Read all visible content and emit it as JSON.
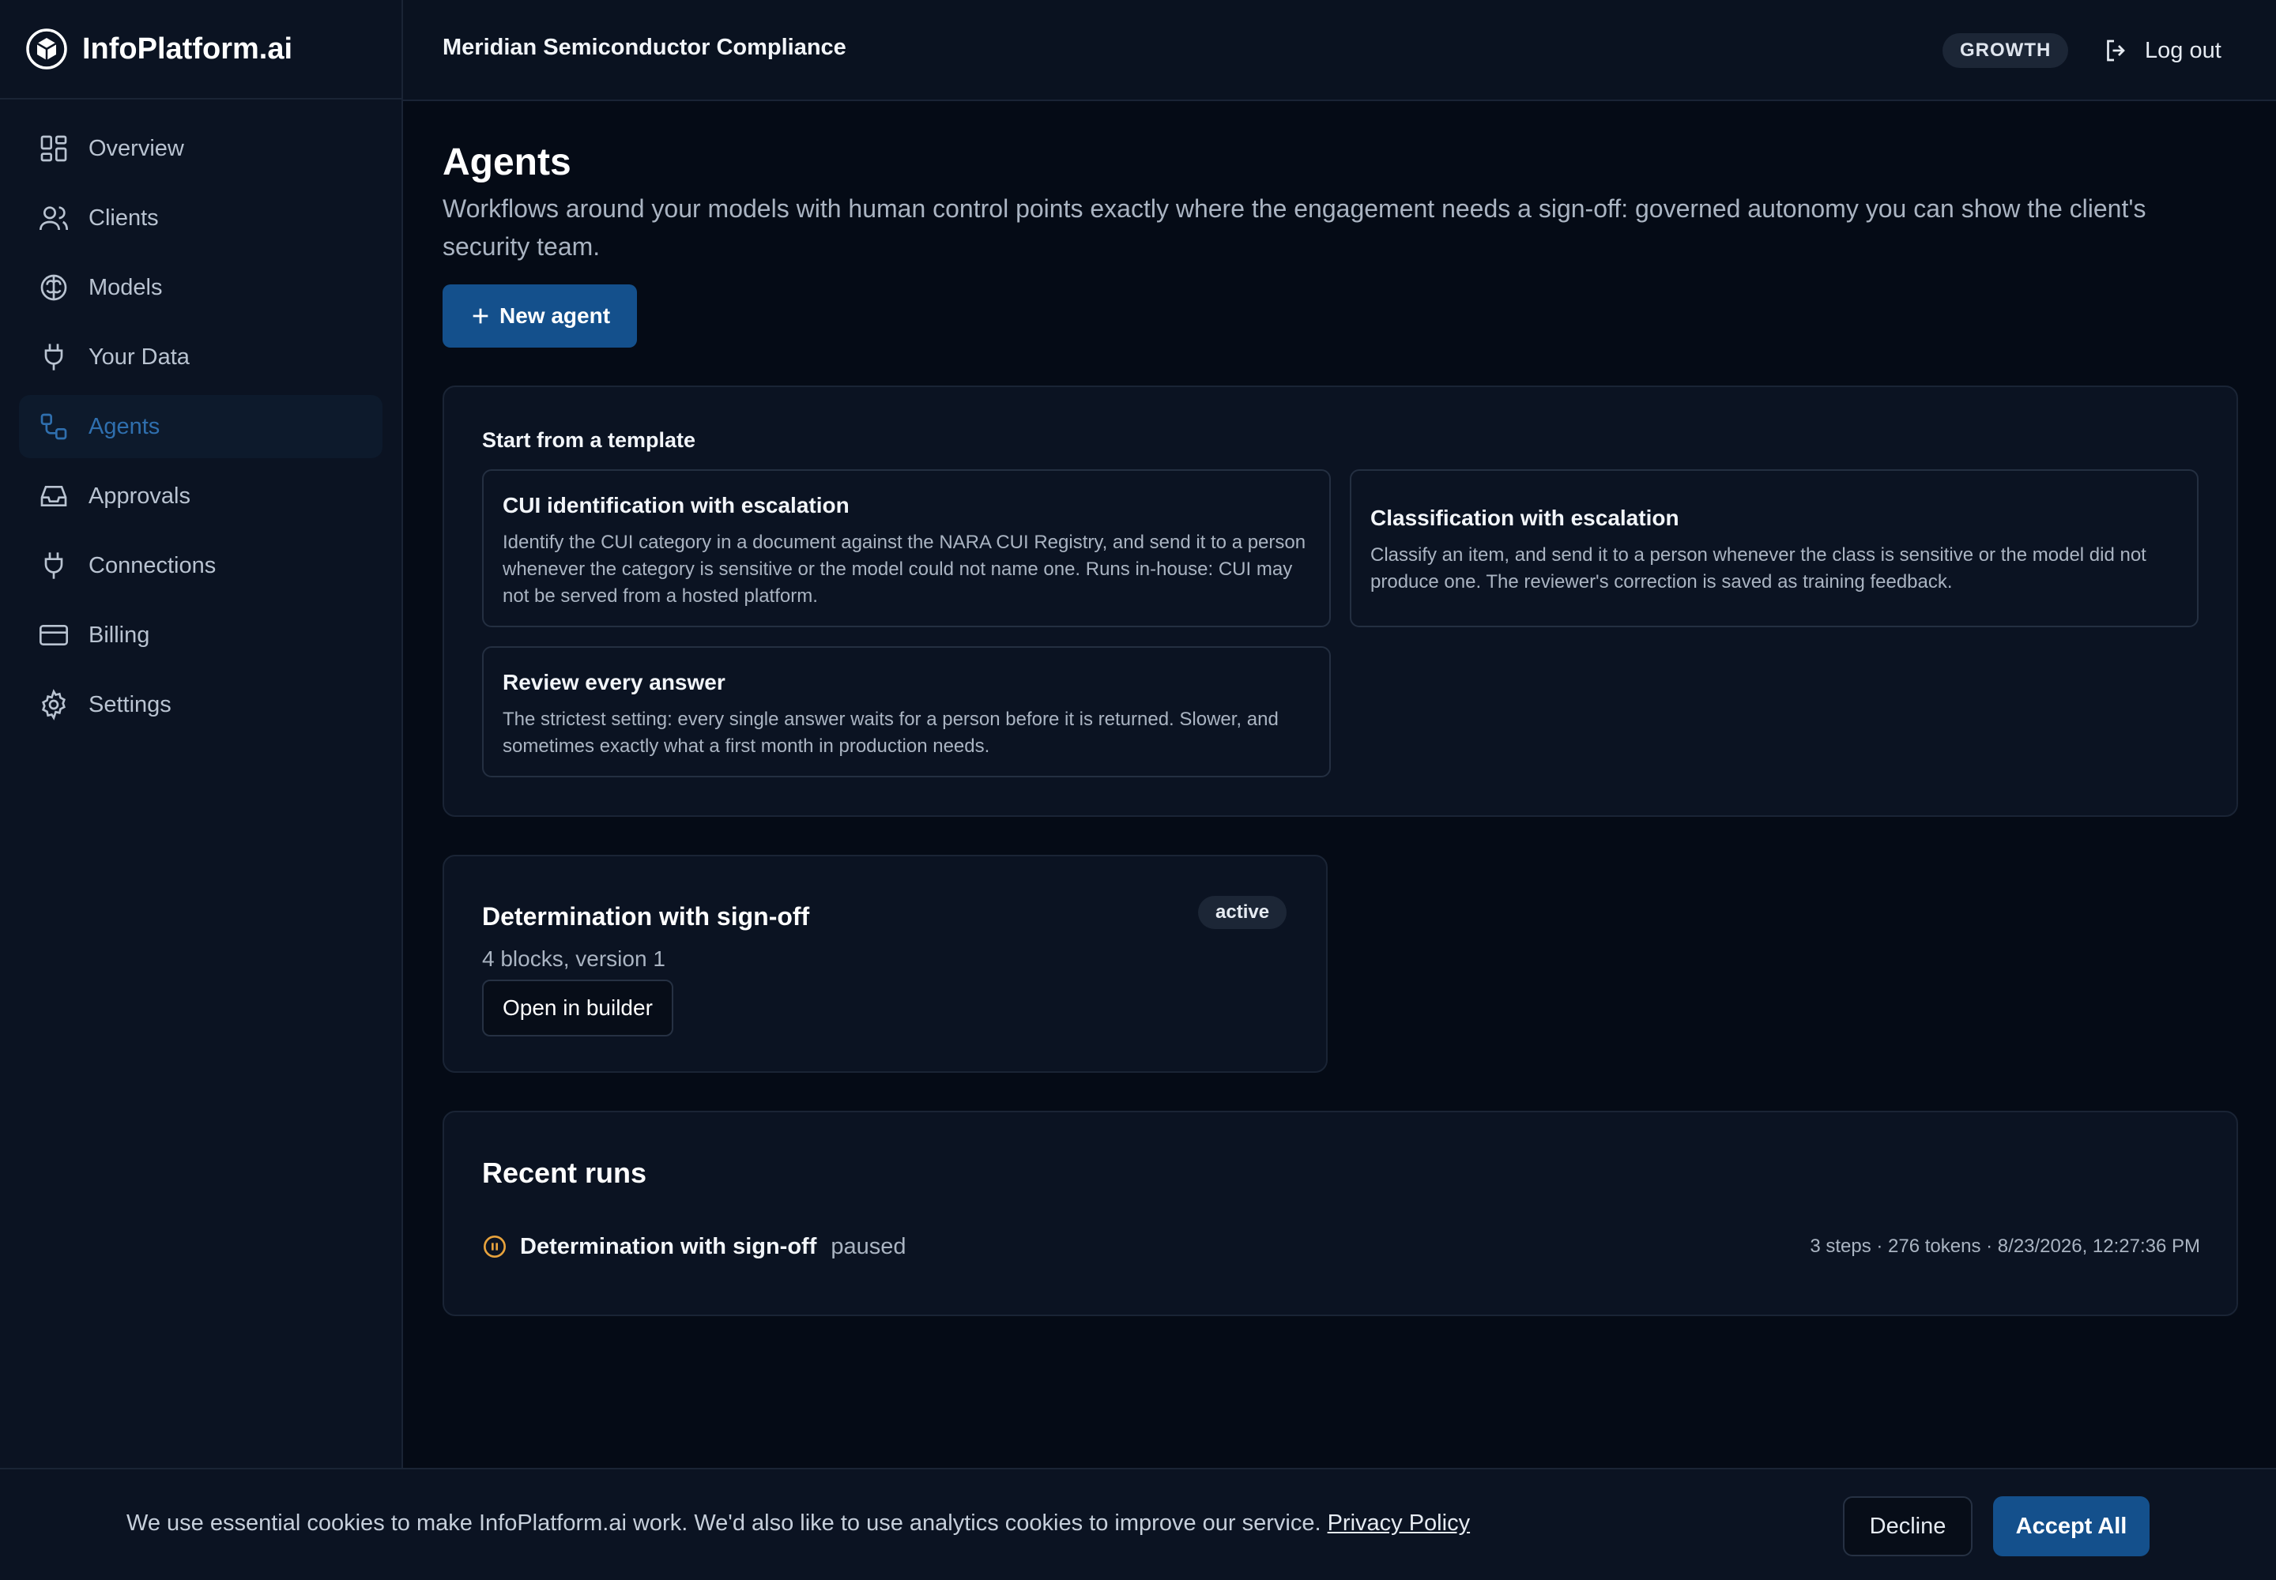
{
  "brand": {
    "name": "InfoPlatform.ai",
    "logo_icon": "cube-icon"
  },
  "sidebar": {
    "items": [
      {
        "label": "Overview",
        "icon": "dashboard-grid-icon",
        "active": false
      },
      {
        "label": "Clients",
        "icon": "users-icon",
        "active": false
      },
      {
        "label": "Models",
        "icon": "brain-icon",
        "active": false
      },
      {
        "label": "Your Data",
        "icon": "plug-icon",
        "active": false
      },
      {
        "label": "Agents",
        "icon": "workflow-icon",
        "active": true
      },
      {
        "label": "Approvals",
        "icon": "inbox-icon",
        "active": false
      },
      {
        "label": "Connections",
        "icon": "plug-icon",
        "active": false
      },
      {
        "label": "Billing",
        "icon": "credit-card-icon",
        "active": false
      },
      {
        "label": "Settings",
        "icon": "gear-icon",
        "active": false
      }
    ]
  },
  "header": {
    "org_name": "Meridian Semiconductor Compliance",
    "plan": "GROWTH",
    "logout_label": "Log out"
  },
  "main": {
    "title": "Agents",
    "description": "Workflows around your models with human control points exactly where the engagement needs a sign-off: governed autonomy you can show the client's security team.",
    "new_agent_label": "New agent",
    "templates": {
      "heading": "Start from a template",
      "items": [
        {
          "title": "CUI identification with escalation",
          "description": "Identify the CUI category in a document against the NARA CUI Registry, and send it to a person whenever the category is sensitive or the model could not name one. Runs in-house: CUI may not be served from a hosted platform."
        },
        {
          "title": "Classification with escalation",
          "description": "Classify an item, and send it to a person whenever the class is sensitive or the model did not produce one. The reviewer's correction is saved as training feedback."
        },
        {
          "title": "Review every answer",
          "description": "The strictest setting: every single answer waits for a person before it is returned. Slower, and sometimes exactly what a first month in production needs."
        }
      ]
    },
    "agents": [
      {
        "name": "Determination with sign-off",
        "status": "active",
        "meta": "4 blocks, version 1",
        "open_label": "Open in builder"
      }
    ],
    "recent_runs": {
      "heading": "Recent runs",
      "items": [
        {
          "name": "Determination with sign-off",
          "status": "paused",
          "status_icon": "pause-circle-icon",
          "meta": "3 steps · 276 tokens · 8/23/2026, 12:27:36 PM"
        }
      ]
    }
  },
  "cookie_banner": {
    "text": "We use essential cookies to make InfoPlatform.ai work. We'd also like to use analytics cookies to improve our service.",
    "link_label": "Privacy Policy",
    "decline_label": "Decline",
    "accept_label": "Accept All"
  },
  "colors": {
    "background": "#050b16",
    "sidebar": "#0b1322",
    "accent": "#14508c",
    "active_nav_text": "#2f6fae",
    "paused": "#e8a33d"
  }
}
